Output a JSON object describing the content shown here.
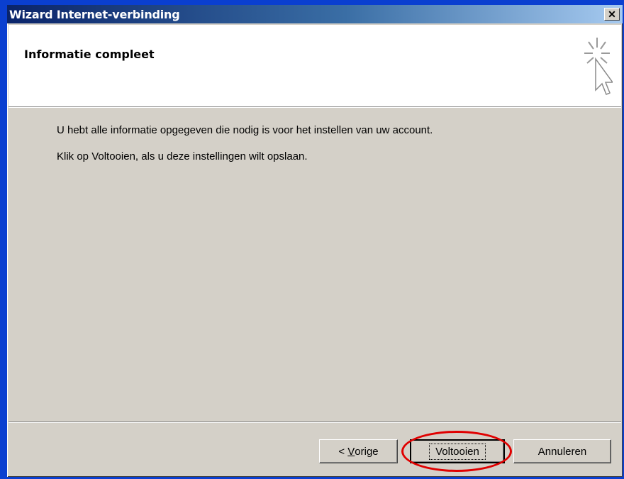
{
  "window": {
    "title": "Wizard Internet-verbinding",
    "close_glyph": "✕"
  },
  "header": {
    "title": "Informatie compleet",
    "icon": "wizard-cursor-icon"
  },
  "body": {
    "line1": "U hebt alle informatie opgegeven die nodig is voor het instellen van uw account.",
    "line2": "Klik op Voltooien, als u deze instellingen wilt opslaan."
  },
  "buttons": {
    "back_prefix": "< ",
    "back_mnemonic": "V",
    "back_rest": "orige",
    "finish": "Voltooien",
    "cancel": "Annuleren"
  },
  "colors": {
    "highlight": "#e00000",
    "titlebar_start": "#0a246a",
    "titlebar_end": "#a6caf0",
    "dialog_bg": "#d4d0c8",
    "desktop": "#0a3fd0"
  }
}
